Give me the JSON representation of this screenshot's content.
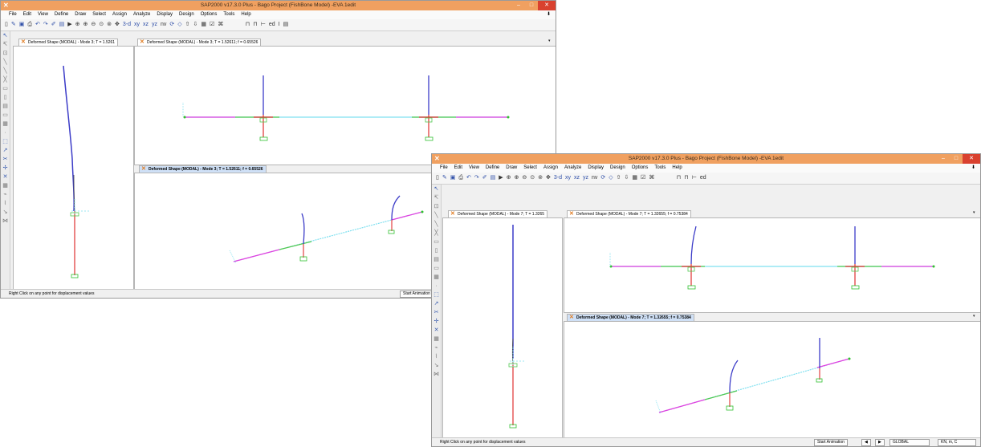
{
  "window_back": {
    "title": "SAP2000 v17.3.0 Plus - Bago Project (FishBone Model) -EVA 1edit",
    "tab_left": "Deformed Shape (MODAL) - Mode 3; T = 1.5261",
    "tab_top": "Deformed Shape (MODAL) - Mode 3; T = 1.52611; f = 0.65526",
    "tab_bottom": "Deformed Shape (MODAL) - Mode 3; T = 1.52611; f = 0.65526",
    "status_message": "Right Click on any point for displacement values",
    "start_animation": "Start Animation"
  },
  "window_front": {
    "title": "SAP2000 v17.3.0 Plus - Bago Project (FishBone Model) -EVA 1edit",
    "tab_left": "Deformed Shape (MODAL) - Mode 7; T = 1.3265",
    "tab_top": "Deformed Shape (MODAL) - Mode 7; T = 1.32655; f = 0.75384",
    "tab_bottom": "Deformed Shape (MODAL) - Mode 7; T = 1.32655; f = 0.75384",
    "status_message": "Right Click on any point for displacement values",
    "start_animation": "Start Animation",
    "coord_system": "GLOBAL",
    "units": "KN, m, C"
  },
  "menu": [
    "File",
    "Edit",
    "View",
    "Define",
    "Draw",
    "Select",
    "Assign",
    "Analyze",
    "Display",
    "Design",
    "Options",
    "Tools",
    "Help"
  ],
  "toolbar": {
    "view_3d": "3-d",
    "view_xy": "xy",
    "view_xz": "xz",
    "view_yz": "yz",
    "view_nv": "nv",
    "view_ed": "ed"
  },
  "icons": {
    "close": "close-icon",
    "minimize": "minimize-icon",
    "maximize": "maximize-icon",
    "deformed_tab": "x-frame-icon"
  },
  "colors": {
    "titlebar": "#f0a060",
    "close": "#d9412f",
    "active_tab": "#cfe0f6",
    "column_top": "#3c3cc8",
    "column_bottom": "#e03030",
    "deck": "#7fe0f0",
    "deck_magenta": "#e040e0",
    "deck_green": "#50c850",
    "footing": "#30c030"
  }
}
